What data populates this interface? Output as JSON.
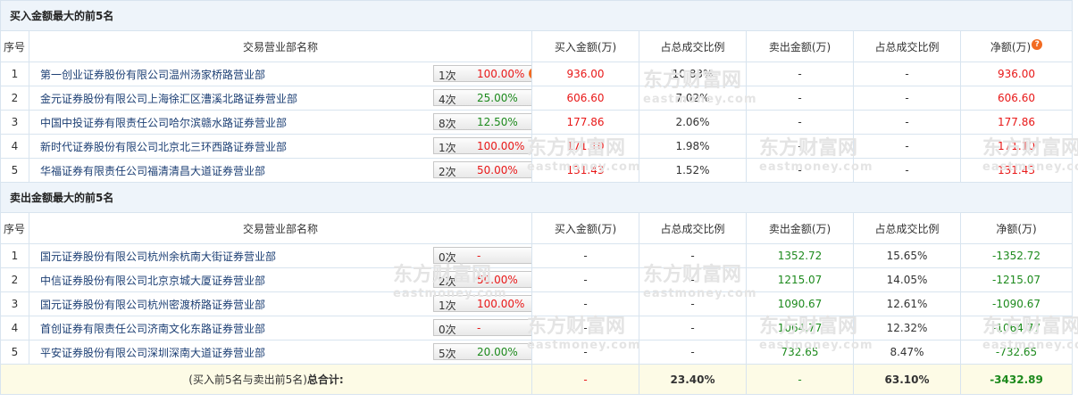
{
  "buy_section": {
    "title": "买入金额最大的前5名",
    "headers": [
      "序号",
      "交易营业部名称",
      "买入金额(万)",
      "占总成交比例",
      "卖出金额(万)",
      "占总成交比例",
      "净额(万)"
    ],
    "rows": [
      {
        "no": "1",
        "name": "第一创业证券股份有限公司温州汤家桥路营业部",
        "count": "1次",
        "rate": "100.00%",
        "rate_color": "red",
        "has_q": true,
        "buy": "936.00",
        "buy_ratio": "10.83%",
        "sell": "-",
        "sell_ratio": "-",
        "net": "936.00"
      },
      {
        "no": "2",
        "name": "金元证券股份有限公司上海徐汇区漕溪北路证券营业部",
        "count": "4次",
        "rate": "25.00%",
        "rate_color": "green",
        "has_q": false,
        "buy": "606.60",
        "buy_ratio": "7.02%",
        "sell": "-",
        "sell_ratio": "-",
        "net": "606.60"
      },
      {
        "no": "3",
        "name": "中国中投证券有限责任公司哈尔滨赣水路证券营业部",
        "count": "8次",
        "rate": "12.50%",
        "rate_color": "green",
        "has_q": false,
        "buy": "177.86",
        "buy_ratio": "2.06%",
        "sell": "-",
        "sell_ratio": "-",
        "net": "177.86"
      },
      {
        "no": "4",
        "name": "新时代证券股份有限公司北京北三环西路证券营业部",
        "count": "1次",
        "rate": "100.00%",
        "rate_color": "red",
        "has_q": false,
        "buy": "171.10",
        "buy_ratio": "1.98%",
        "sell": "-",
        "sell_ratio": "-",
        "net": "171.10"
      },
      {
        "no": "5",
        "name": "华福证券有限责任公司福清清昌大道证券营业部",
        "count": "2次",
        "rate": "50.00%",
        "rate_color": "red",
        "has_q": false,
        "buy": "131.43",
        "buy_ratio": "1.52%",
        "sell": "-",
        "sell_ratio": "-",
        "net": "131.43"
      }
    ]
  },
  "sell_section": {
    "title": "卖出金额最大的前5名",
    "headers": [
      "序号",
      "交易营业部名称",
      "买入金额(万)",
      "占总成交比例",
      "卖出金额(万)",
      "占总成交比例",
      "净额(万)"
    ],
    "rows": [
      {
        "no": "1",
        "name": "国元证券股份有限公司杭州余杭南大街证券营业部",
        "count": "0次",
        "rate": "-",
        "rate_color": "red",
        "has_q": false,
        "buy": "-",
        "buy_ratio": "-",
        "sell": "1352.72",
        "sell_ratio": "15.65%",
        "net": "-1352.72"
      },
      {
        "no": "2",
        "name": "中信证券股份有限公司北京京城大厦证券营业部",
        "count": "2次",
        "rate": "50.00%",
        "rate_color": "red",
        "has_q": false,
        "buy": "-",
        "buy_ratio": "-",
        "sell": "1215.07",
        "sell_ratio": "14.05%",
        "net": "-1215.07"
      },
      {
        "no": "3",
        "name": "国元证券股份有限公司杭州密渡桥路证券营业部",
        "count": "1次",
        "rate": "100.00%",
        "rate_color": "red",
        "has_q": false,
        "buy": "-",
        "buy_ratio": "-",
        "sell": "1090.67",
        "sell_ratio": "12.61%",
        "net": "-1090.67"
      },
      {
        "no": "4",
        "name": "首创证券有限责任公司济南文化东路证券营业部",
        "count": "0次",
        "rate": "-",
        "rate_color": "red",
        "has_q": false,
        "buy": "-",
        "buy_ratio": "-",
        "sell": "1064.77",
        "sell_ratio": "12.32%",
        "net": "-1064.77"
      },
      {
        "no": "5",
        "name": "平安证券股份有限公司深圳深南大道证券营业部",
        "count": "5次",
        "rate": "20.00%",
        "rate_color": "green",
        "has_q": false,
        "buy": "-",
        "buy_ratio": "-",
        "sell": "732.65",
        "sell_ratio": "8.47%",
        "net": "-732.65"
      }
    ]
  },
  "total": {
    "label": "(买入前5名与卖出前5名)",
    "label_bold": "总合计:",
    "buy": "-",
    "buy_ratio": "23.40%",
    "sell": "-",
    "sell_ratio": "63.10%",
    "net": "-3432.89"
  },
  "watermark": {
    "cn": "东方财富网",
    "en": "eastmoney.com"
  },
  "question_mark": "?",
  "colors": {
    "up": "#e81818",
    "down": "#1d8a1d",
    "section_bg": "#eef4fa",
    "total_bg": "#fdfbe6",
    "border": "#d8e4ef"
  }
}
